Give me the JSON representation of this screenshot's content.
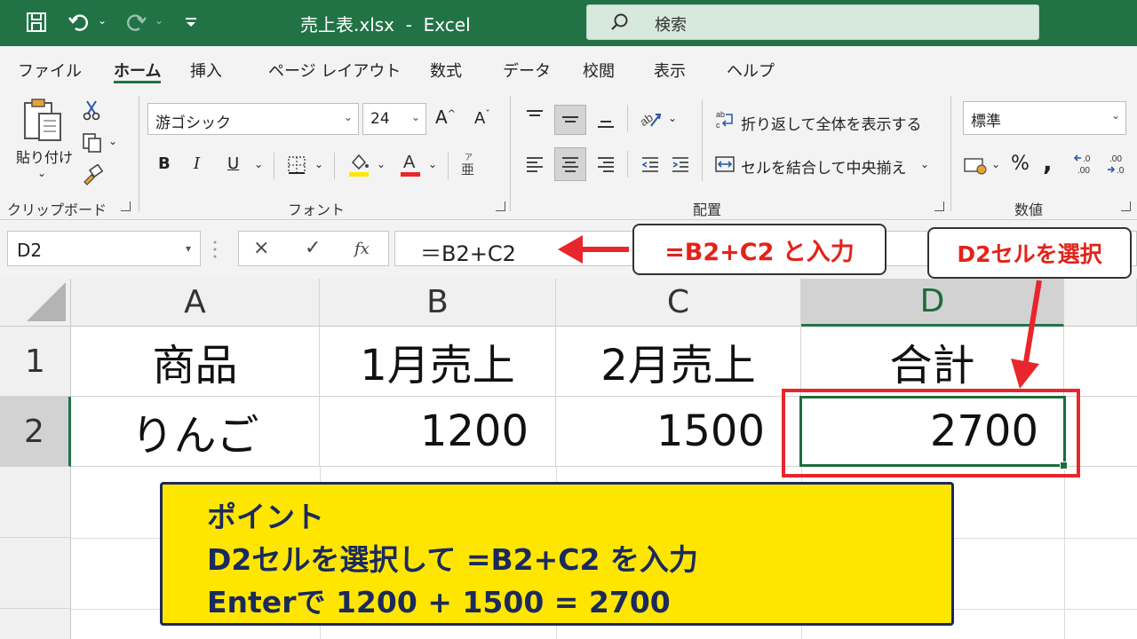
{
  "titlebar": {
    "title": "売上表.xlsx  -  Excel",
    "search_placeholder": "検索",
    "icons": [
      "save-icon",
      "undo-icon",
      "redo-icon",
      "customize-toolbar-icon"
    ]
  },
  "tabs": [
    "ファイル",
    "ホーム",
    "挿入",
    "ページ レイアウト",
    "数式",
    "データ",
    "校閲",
    "表示",
    "ヘルプ"
  ],
  "active_tab": "ホーム",
  "ribbon": {
    "clipboard": {
      "paste_label": "貼り付け",
      "group_label": "クリップボード"
    },
    "font": {
      "font_name": "游ゴシック",
      "font_size": "24",
      "bold": "B",
      "italic": "I",
      "underline": "U",
      "group_label": "フォント"
    },
    "alignment": {
      "wrap_text": "折り返して全体を表示する",
      "merge_center": "セルを結合して中央揃え",
      "group_label": "配置"
    },
    "number": {
      "format": "標準",
      "percent": "%",
      "comma": ",",
      "group_label": "数値"
    }
  },
  "formula_bar": {
    "name_box": "D2",
    "cancel": "×",
    "enter": "✓",
    "fx": "fx",
    "formula": "＝B2+C2"
  },
  "sheet": {
    "columns": [
      "A",
      "B",
      "C",
      "D"
    ],
    "rows": [
      "1",
      "2"
    ],
    "cells": {
      "A1": "商品",
      "B1": "1月売上",
      "C1": "2月売上",
      "D1": "合計",
      "A2": "りんご",
      "B2": "1200",
      "C2": "1500",
      "D2": "2700"
    },
    "selected_cell": "D2"
  },
  "annotations": {
    "formula_callout": "=B2+C2 と入力",
    "cell_callout": "D2セルを選択",
    "point_title": "ポイント",
    "point_line1": "D2セルを選択して =B2+C2 を入力",
    "point_line2": "Enterで 1200 + 1500 = 2700"
  },
  "colors": {
    "excel_green": "#217346",
    "callout_red": "#e2231a",
    "point_yellow": "#ffe600",
    "point_navy": "#1b2a5c"
  }
}
